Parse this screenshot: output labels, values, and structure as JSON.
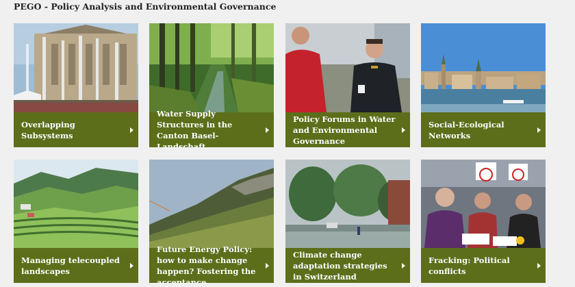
{
  "header": {
    "title": "PEGO - Policy Analysis and Environmental Governance"
  },
  "tiles": [
    {
      "label": "Overlapping Subsystems",
      "image": "fountains-parliament",
      "arrow_icon": "chevron-right-icon"
    },
    {
      "label": "Water Supply Structures in the Canton Basel-Landschaft",
      "image": "forest-stream",
      "arrow_icon": "chevron-right-icon"
    },
    {
      "label": "Policy Forums in Water and Environmental Governance",
      "image": "two-men-talking",
      "arrow_icon": "chevron-right-icon"
    },
    {
      "label": "Social-Ecological Networks",
      "image": "zurich-lake-city",
      "arrow_icon": "chevron-right-icon"
    },
    {
      "label": "Managing telecoupled landscapes",
      "image": "tea-plantation-hills",
      "arrow_icon": "chevron-right-icon"
    },
    {
      "label": "Future Energy Policy: how to make change happen? Fostering the acceptance",
      "image": "mountain-slope",
      "arrow_icon": "chevron-right-icon"
    },
    {
      "label": "Climate change adaptation strategies in Switzerland",
      "image": "flooded-street",
      "arrow_icon": "chevron-right-icon"
    },
    {
      "label": "Fracking: Political conflicts",
      "image": "stop-fracking-protest",
      "arrow_icon": "chevron-right-icon"
    }
  ],
  "colors": {
    "caption_bg": "#5c6e1a",
    "page_bg": "#f0f0f0",
    "title_text": "#222222"
  }
}
